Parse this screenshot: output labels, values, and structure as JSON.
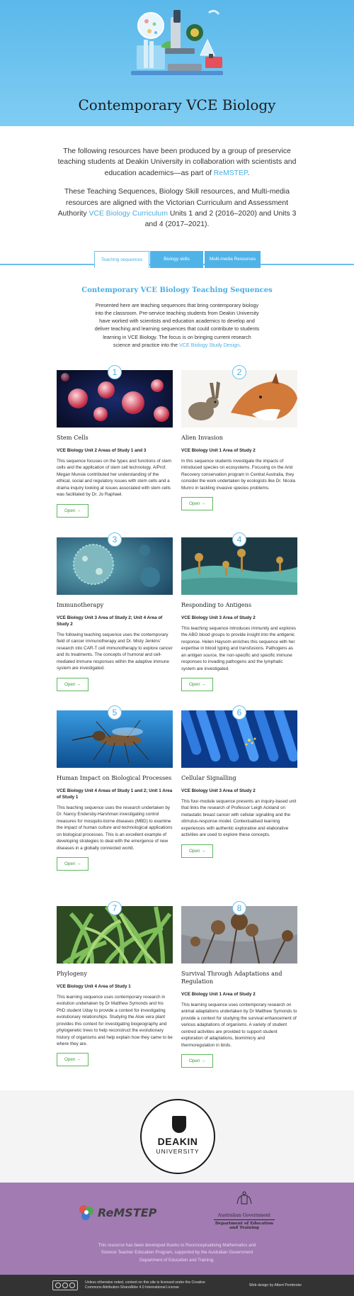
{
  "hero": {
    "title": "Contemporary VCE Biology"
  },
  "intro": {
    "p1_before": "The following resources have been produced by a group of preservice teaching students at Deakin University in collaboration with scientists and education academics—as part of ",
    "p1_link": "ReMSTEP",
    "p1_after": ".",
    "p2_before": "These Teaching Sequences, Biology Skill resources, and Multi-media resources are aligned with the Victorian Curriculum and Assessment Authority ",
    "p2_link": "VCE Biology Curriculum",
    "p2_after": " Units 1 and 2 (2016–2020) and Units 3 and 4 (2017–2021)."
  },
  "tabs": [
    {
      "label": "Teaching sequences",
      "active": true
    },
    {
      "label": "Biology skills",
      "active": false
    },
    {
      "label": "Multi-media Resources",
      "active": false
    }
  ],
  "section": {
    "title": "Contemporary VCE Biology Teaching Sequences",
    "desc_before": "Presented here are teaching sequences that bring contemporary biology into the classroom. Pre-service teaching students from Deakin University have worked with scientists and education academics to develop and deliver teaching and learning sequences that could contribute to students learning in VCE Biology. The focus is on bringing current research science and practice into the ",
    "desc_link": "VCE Biology Study Design",
    "desc_after": "."
  },
  "cards": [
    {
      "num": "1",
      "title": "Stem Cells",
      "unit": "VCE Biology Unit 2 Areas of Study 1 and 3",
      "desc": "This sequence focuses on the types and functions of stem cells and the application of stem cell technology. A/Prof. Megan Munsie contributed her understanding of the ethical, social and regulatory issues with stem cells and a drama inquiry looking at issues associated with stem cells was facilitated by Dr. Jo Raphael.",
      "button": "Open →"
    },
    {
      "num": "2",
      "title": "Alien Invasion",
      "unit": "VCE Biology Unit 1 Area of Study 2",
      "desc": "In this sequence students investigate the impacts of introduced species on ecosystems. Focusing on the Arid Recovery conservation program in Central Australia, they consider the work undertaken by ecologists like Dr. Nicola Munro in tackling invasive species problems.",
      "button": "Open →"
    },
    {
      "num": "3",
      "title": "Immunotherapy",
      "unit": "VCE Biology Unit 3 Area of Study 2; Unit 4 Area of Study 2",
      "desc": "The following teaching sequence uses the contemporary field of cancer immunotherapy and Dr. Misty Jenkins' research into CAR-T cell immunotherapy to explore cancer and its treatments. The concepts of humoral and cell-mediated immune responses within the adaptive immune system are investigated.",
      "button": "Open →"
    },
    {
      "num": "4",
      "title": "Responding to Antigens",
      "unit": "VCE Biology Unit 3 Area of Study 2",
      "desc": "This teaching sequence introduces immunity and explores the ABO blood groups to provide insight into the antigenic response. Helen Haysom enriches this sequence with her expertise in blood typing and transfusions. Pathogens as an antigen source, the non-specific and specific immune responses to invading pathogens and the lymphatic system are investigated.",
      "button": "Open →"
    },
    {
      "num": "5",
      "title": "Human Impact on Biological Processes",
      "unit": "VCE Biology Unit 4 Areas of Study 1 and 2; Unit 1 Area of Study 1",
      "desc": "This teaching sequence uses the research undertaken by Dr. Nancy Endersby-Harshman investigating control measures for mosquito-borne diseases (MBD) to examine the impact of human culture and technological applications on biological processes. This is an excellent example of developing strategies to deal with the emergence of new diseases in a globally connected world.",
      "button": "Open →"
    },
    {
      "num": "6",
      "title": "Cellular Signalling",
      "unit": "VCE Biology Unit 3 Area of Study 2",
      "desc": "This four-module sequence presents an inquiry-based unit that links the research of Professor Leigh Ackland on metastatic breast cancer with cellular signalling and the stimulus-response model. Contextualised learning experiences with authentic explorative and elaborative activities are used to explore these concepts.",
      "button": "Open →"
    },
    {
      "num": "7",
      "title": "Phylogeny",
      "unit": "VCE Biology Unit 4 Area of Study 1",
      "desc": "This learning sequence uses contemporary research in evolution undertaken by Dr Matthew Symonds and his PhD student Uday to provide a context for investigating evolutionary relationships. Studying the Aloe vera plant provides this context for investigating biogeography and phylogenetic trees to help reconstruct the evolutionary history of organisms and help explain how they came to be where they are.",
      "button": "Open →"
    },
    {
      "num": "8",
      "title": "Survival Through Adaptations and Regulation",
      "unit": "VCE Biology Unit 1 Area of Study 2",
      "desc": "This learning sequence uses contemporary research on animal adaptations undertaken by Dr Matthew Symonds to provide a context for studying the survival enhancement of various adaptations of organisms. A variety of student centred activities are provided to support student exploration of adaptations, biomimicry and thermoregulation in birds.",
      "button": "Open →"
    }
  ],
  "deakin": {
    "name": "DEAKIN",
    "sub": "UNIVERSITY"
  },
  "footer": {
    "remstep": "ReMSTEP",
    "gov_line1": "Australian Government",
    "gov_line2": "Department of Education and Training",
    "note": "This resource has been developed thanks to Reconceptualising Mathematics and Science Teacher Education Program, supported by the Australian Government Department of Education and Training.",
    "license": "Unless otherwise noted, content on this site is licensed under the Creative Commons Attribution-ShareAlike 4.0 International License",
    "credit": "Web design by Albert Pembroke"
  },
  "colors": {
    "accent": "#4aaee4",
    "open_button": "#5cb85c",
    "footer_purple": "#a17bb2",
    "footer_dark": "#333333"
  }
}
